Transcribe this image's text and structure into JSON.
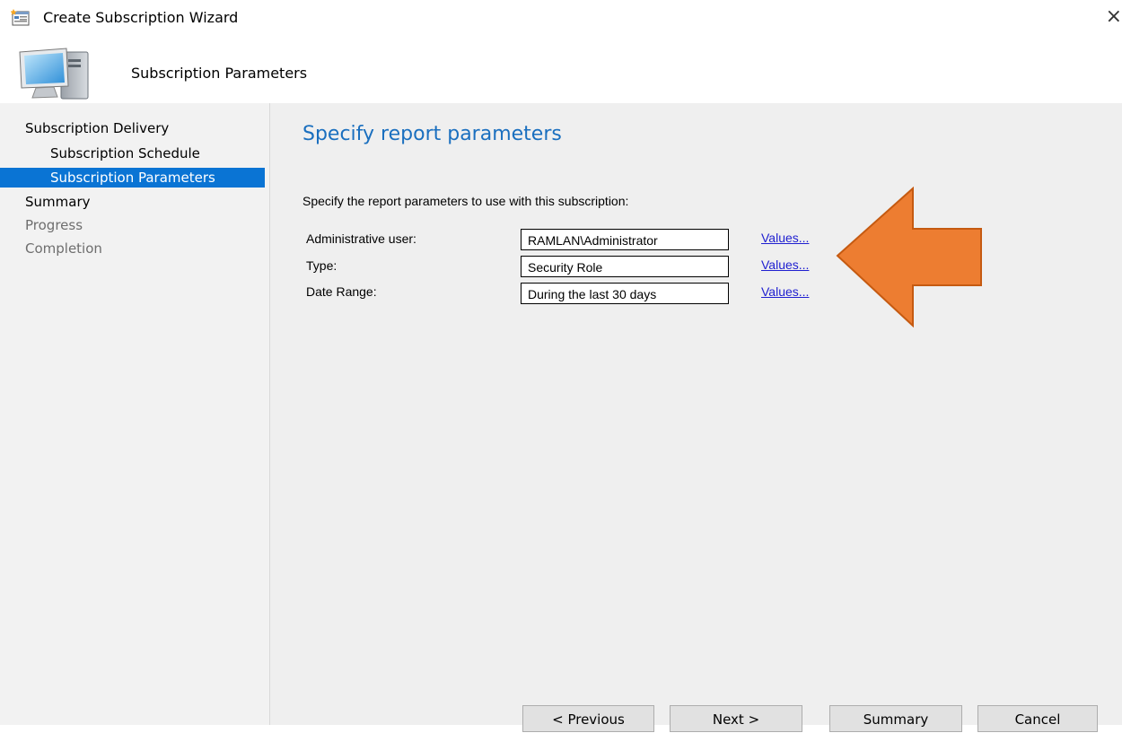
{
  "window": {
    "title": "Create Subscription Wizard",
    "close_glyph": "×"
  },
  "header": {
    "subtitle": "Subscription Parameters"
  },
  "nav": {
    "items": [
      {
        "label": "Subscription Delivery",
        "state": "normal"
      },
      {
        "label": "Subscription Schedule",
        "state": "normal"
      },
      {
        "label": "Subscription Parameters",
        "state": "selected"
      },
      {
        "label": "Summary",
        "state": "normal"
      },
      {
        "label": "Progress",
        "state": "disabled"
      },
      {
        "label": "Completion",
        "state": "disabled"
      }
    ]
  },
  "main": {
    "heading": "Specify report parameters",
    "description": "Specify the report parameters to use with this subscription:",
    "parameters": [
      {
        "label": "Administrative user:",
        "value": "RAMLAN\\Administrator",
        "link": "Values..."
      },
      {
        "label": "Type:",
        "value": "Security Role",
        "link": "Values..."
      },
      {
        "label": "Date Range:",
        "value": "During the last 30 days",
        "link": "Values..."
      }
    ]
  },
  "buttons": {
    "previous": "< Previous",
    "next": "Next >",
    "summary": "Summary",
    "cancel": "Cancel"
  },
  "colors": {
    "accent": "#0a74d4",
    "heading": "#1a6fbf",
    "link": "#1f1fd0",
    "annotation_arrow": "#ed7d31"
  }
}
